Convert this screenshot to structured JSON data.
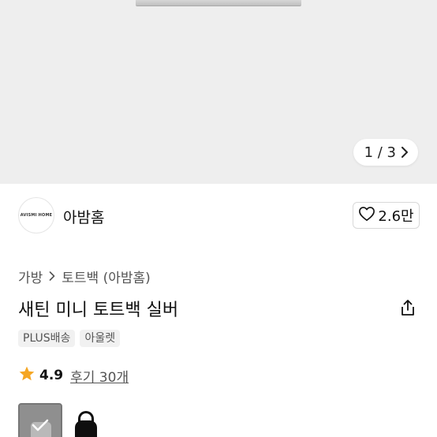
{
  "gallery": {
    "counter": "1 / 3"
  },
  "seller": {
    "logo_text": "AVISMI HOME",
    "name": "아밤홈"
  },
  "like": {
    "count": "2.6만"
  },
  "breadcrumb": {
    "category": "가방",
    "subcategory": "토트백 (아밤홈)"
  },
  "product": {
    "title": "새틴 미니 토트백 실버",
    "tags": [
      "PLUS배송",
      "아울렛"
    ]
  },
  "rating": {
    "score": "4.9",
    "reviews": "후기 30개"
  },
  "colors": {
    "star": "#F5A623",
    "hero_bg": "#EEEEEE",
    "tag_bg": "#F1F1F1"
  },
  "icons": {
    "chevron": "chevron-right-icon",
    "heart": "heart-icon",
    "share": "share-icon",
    "star": "star-icon",
    "check": "check-icon"
  }
}
